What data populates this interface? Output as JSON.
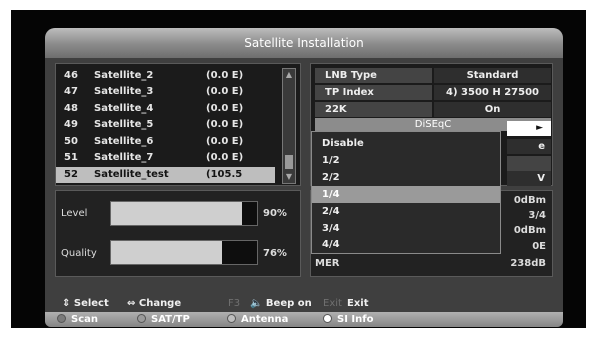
{
  "title": "Satellite Installation",
  "satellites": [
    {
      "num": "46",
      "name": "Satellite_2",
      "pos": "(0.0 E)"
    },
    {
      "num": "47",
      "name": "Satellite_3",
      "pos": "(0.0 E)"
    },
    {
      "num": "48",
      "name": "Satellite_4",
      "pos": "(0.0 E)"
    },
    {
      "num": "49",
      "name": "Satellite_5",
      "pos": "(0.0 E)"
    },
    {
      "num": "50",
      "name": "Satellite_6",
      "pos": "(0.0 E)"
    },
    {
      "num": "51",
      "name": "Satellite_7",
      "pos": "(0.0 E)"
    },
    {
      "num": "52",
      "name": "Satellite_test",
      "pos": "(105.5"
    }
  ],
  "settings": {
    "lnb_label": "LNB Type",
    "lnb_value": "Standard",
    "tp_label": "TP Index",
    "tp_value": "4) 3500 H 27500",
    "k22_label": "22K",
    "k22_value": "On",
    "diseqc_label": "DiSEqC",
    "partial_1": "e",
    "partial_2": "V",
    "arrow": "►"
  },
  "diseqc_options": [
    "Disable",
    "1/2",
    "2/2",
    "1/4",
    "2/4",
    "3/4",
    "4/4"
  ],
  "diseqc_selected_index": 3,
  "signal": {
    "level_label": "Level",
    "level_pct": "90%",
    "level_fraction": 0.9,
    "quality_label": "Quality",
    "quality_pct": "76%",
    "quality_fraction": 0.76
  },
  "info": {
    "v1": "0dBm",
    "v2": "3/4",
    "v3": "0dBm",
    "v4": "0E",
    "mer_label": "MER",
    "mer_value": "238dB"
  },
  "help": {
    "select": "⇕ Select",
    "change": "⇔ Change",
    "f3": "F3",
    "beep": "🔈 Beep on",
    "exit_key": "Exit",
    "exit": "Exit"
  },
  "color_buttons": [
    {
      "label": "Scan",
      "color": "#7a7a7a"
    },
    {
      "label": "SAT/TP",
      "color": "#9a9a9a"
    },
    {
      "label": "Antenna",
      "color": "#bdbdbd"
    },
    {
      "label": "SI Info",
      "color": "#ffffff"
    }
  ]
}
